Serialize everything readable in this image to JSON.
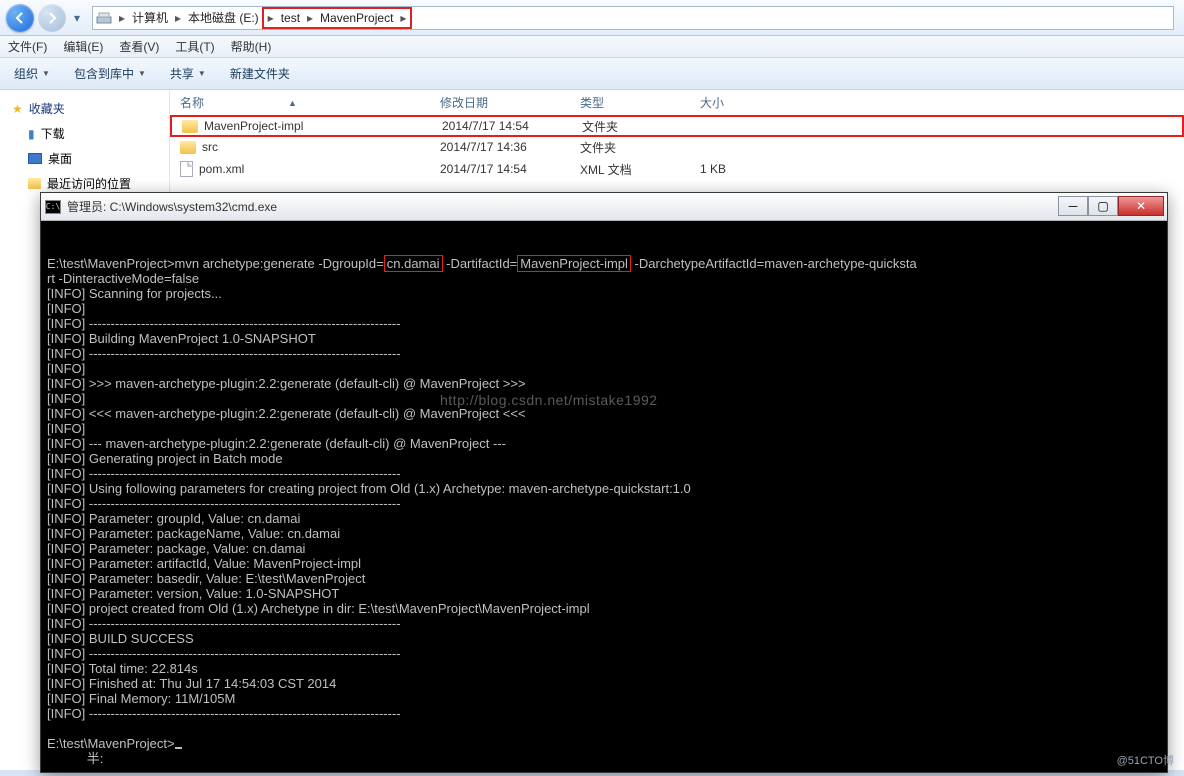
{
  "nav": {
    "crumbs": [
      "计算机",
      "本地磁盘 (E:)",
      "test",
      "MavenProject"
    ]
  },
  "menubar": [
    "文件(F)",
    "编辑(E)",
    "查看(V)",
    "工具(T)",
    "帮助(H)"
  ],
  "toolbar": [
    "组织",
    "包含到库中",
    "共享",
    "新建文件夹"
  ],
  "sidebar": {
    "fav": "收藏夹",
    "dl": "下载",
    "desk": "桌面",
    "recent": "最近访问的位置"
  },
  "cols": {
    "name": "名称",
    "date": "修改日期",
    "type": "类型",
    "size": "大小"
  },
  "rows": [
    {
      "name": "MavenProject-impl",
      "date": "2014/7/17 14:54",
      "type": "文件夹",
      "size": ""
    },
    {
      "name": "src",
      "date": "2014/7/17 14:36",
      "type": "文件夹",
      "size": ""
    },
    {
      "name": "pom.xml",
      "date": "2014/7/17 14:54",
      "type": "XML 文档",
      "size": "1 KB"
    }
  ],
  "cmd": {
    "title": "管理员: C:\\Windows\\system32\\cmd.exe",
    "prompt1a": "E:\\test\\MavenProject>mvn archetype:generate -DgroupId=",
    "groupId": "cn.damai",
    "prompt1b": " -DartifactId=",
    "artifactId": "MavenProject-impl",
    "prompt1c": " -DarchetypeArtifactId=maven-archetype-quicksta",
    "prompt1d": "rt -DinteractiveMode=false",
    "l01": "[INFO] Scanning for projects...",
    "l02": "[INFO]",
    "l03": "[INFO] ------------------------------------------------------------------------",
    "l04": "[INFO] Building MavenProject 1.0-SNAPSHOT",
    "l05": "[INFO] ------------------------------------------------------------------------",
    "l06": "[INFO]",
    "l07": "[INFO] >>> maven-archetype-plugin:2.2:generate (default-cli) @ MavenProject >>>",
    "l08": "[INFO]",
    "l09": "[INFO] <<< maven-archetype-plugin:2.2:generate (default-cli) @ MavenProject <<<",
    "l10": "[INFO]",
    "l11": "[INFO] --- maven-archetype-plugin:2.2:generate (default-cli) @ MavenProject ---",
    "l12": "[INFO] Generating project in Batch mode",
    "l13": "[INFO] ------------------------------------------------------------------------",
    "l14": "[INFO] Using following parameters for creating project from Old (1.x) Archetype: maven-archetype-quickstart:1.0",
    "l15": "[INFO] ------------------------------------------------------------------------",
    "l16": "[INFO] Parameter: groupId, Value: cn.damai",
    "l17": "[INFO] Parameter: packageName, Value: cn.damai",
    "l18": "[INFO] Parameter: package, Value: cn.damai",
    "l19": "[INFO] Parameter: artifactId, Value: MavenProject-impl",
    "l20": "[INFO] Parameter: basedir, Value: E:\\test\\MavenProject",
    "l21": "[INFO] Parameter: version, Value: 1.0-SNAPSHOT",
    "l22": "[INFO] project created from Old (1.x) Archetype in dir: E:\\test\\MavenProject\\MavenProject-impl",
    "l23": "[INFO] ------------------------------------------------------------------------",
    "l24": "[INFO] BUILD SUCCESS",
    "l25": "[INFO] ------------------------------------------------------------------------",
    "l26": "[INFO] Total time: 22.814s",
    "l27": "[INFO] Finished at: Thu Jul 17 14:54:03 CST 2014",
    "l28": "[INFO] Final Memory: 11M/105M",
    "l29": "[INFO] ------------------------------------------------------------------------",
    "prompt2": "E:\\test\\MavenProject>",
    "ime": "           半:"
  },
  "watermark": "http://blog.csdn.net/mistake1992",
  "credit": "@51CTO博"
}
